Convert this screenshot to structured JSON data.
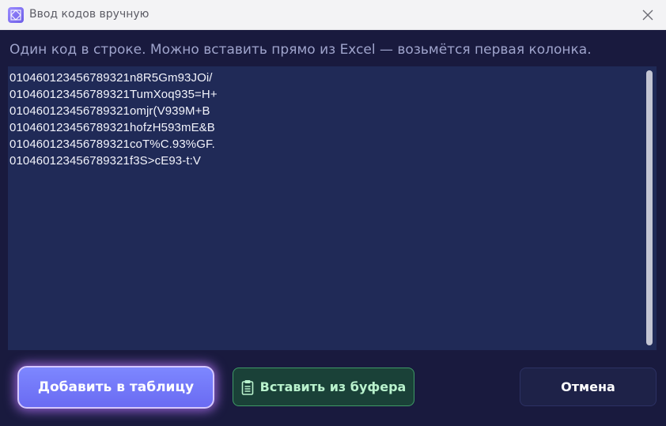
{
  "window": {
    "title": "Ввод кодов вручную"
  },
  "hint": "Один код в строке. Можно вставить прямо из Excel — возьмётся первая колонка.",
  "editor": {
    "lines": [
      "010460123456789321n8R5Gm93JOi/",
      "010460123456789321TumXoq935=H+",
      "010460123456789321omjr(V939M+B",
      "010460123456789321hofzH593mE&B",
      "010460123456789321coT%C.93%GF.",
      "010460123456789321f3S>cE93-t:V"
    ]
  },
  "buttons": {
    "add_label": "Добавить в таблицу",
    "paste_label": "Вставить из буфера",
    "cancel_label": "Отмена"
  },
  "icons": {
    "app": "app-logo-icon",
    "close": "close-icon",
    "clipboard": "clipboard-icon"
  },
  "colors": {
    "background": "#191a3e",
    "accent": "#6a6bf2",
    "paste_accent": "#3f9a66",
    "editor_bg": "#202a57"
  }
}
